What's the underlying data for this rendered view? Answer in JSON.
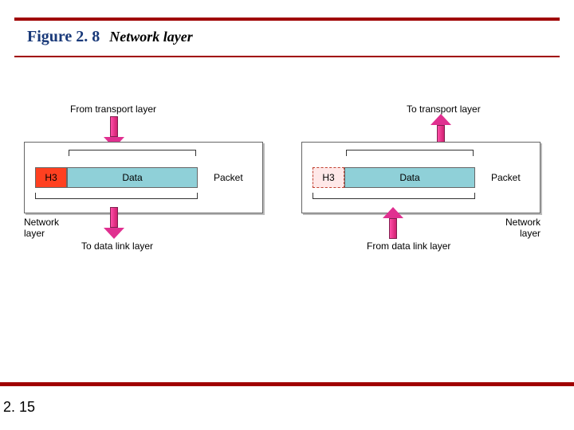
{
  "header": {
    "figure_number": "Figure 2. 8",
    "figure_title": "Network layer"
  },
  "page_number": "2. 15",
  "colors": {
    "rule": "#a00000",
    "header_block": "#ff4020",
    "data_block": "#8fd0d8",
    "arrow": "#e03090"
  },
  "left": {
    "top_label": "From transport layer",
    "header": "H3",
    "data": "Data",
    "packet_label": "Packet",
    "bottom_label": "To data link layer",
    "side_label": "Network\nlayer"
  },
  "right": {
    "top_label": "To transport layer",
    "header": "H3",
    "data": "Data",
    "packet_label": "Packet",
    "bottom_label": "From data link layer",
    "side_label": "Network\nlayer"
  }
}
